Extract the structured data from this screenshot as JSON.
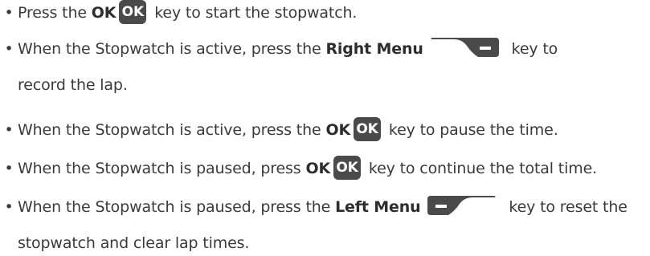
{
  "instructions": [
    {
      "lines": [
        [
          {
            "kind": "text",
            "value": "Press the "
          },
          {
            "kind": "bold",
            "value": "OK"
          },
          {
            "kind": "ok-key",
            "value": "OK"
          },
          {
            "kind": "text",
            "value": " key to start the stopwatch."
          }
        ]
      ]
    },
    {
      "lines": [
        [
          {
            "kind": "text",
            "value": "When the Stopwatch is active, press the "
          },
          {
            "kind": "bold",
            "value": "Right Menu"
          },
          {
            "kind": "right-menu-key",
            "icon": "right-menu-key-icon"
          },
          {
            "kind": "text",
            "value": " key to"
          }
        ],
        [
          {
            "kind": "text",
            "value": "record the lap."
          }
        ]
      ]
    },
    {
      "lines": [
        [
          {
            "kind": "text",
            "value": "When the Stopwatch is active, press the "
          },
          {
            "kind": "bold",
            "value": "OK"
          },
          {
            "kind": "ok-key",
            "value": "OK"
          },
          {
            "kind": "text",
            "value": " key to pause the time."
          }
        ]
      ]
    },
    {
      "lines": [
        [
          {
            "kind": "text",
            "value": "When the Stopwatch is paused, press "
          },
          {
            "kind": "bold",
            "value": "OK"
          },
          {
            "kind": "ok-key",
            "value": "OK"
          },
          {
            "kind": "text",
            "value": " key to continue the total time."
          }
        ]
      ]
    },
    {
      "lines": [
        [
          {
            "kind": "text",
            "value": "When the Stopwatch is paused, press the "
          },
          {
            "kind": "bold",
            "value": "Left Menu"
          },
          {
            "kind": "left-menu-key",
            "icon": "left-menu-key-icon"
          },
          {
            "kind": "text",
            "value": " key to reset the"
          }
        ],
        [
          {
            "kind": "text",
            "value": "stopwatch and clear lap times."
          }
        ]
      ]
    }
  ],
  "bullet_char": "•",
  "colors": {
    "text": "#3a3a3a",
    "key_fill": "#4a4a4a",
    "key_text": "#ffffff"
  }
}
